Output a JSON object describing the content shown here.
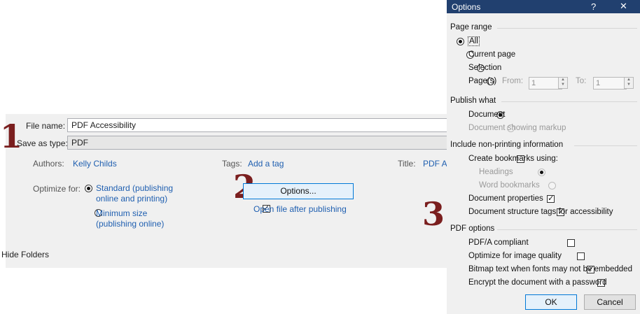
{
  "save_dialog": {
    "file_name_label": "File name:",
    "file_name_value": "PDF Accessibility",
    "save_as_type_label": "Save as type:",
    "save_as_type_value": "PDF",
    "authors_label": "Authors:",
    "authors_value": "Kelly Childs",
    "tags_label": "Tags:",
    "tags_value": "Add a tag",
    "title_label": "Title:",
    "title_value": "PDF Ac",
    "optimize_label": "Optimize for:",
    "optimize_standard_line1": "Standard (publishing",
    "optimize_standard_line2": "online and printing)",
    "optimize_minimum_line1": "Minimum size",
    "optimize_minimum_line2": "(publishing online)",
    "options_button": "Options...",
    "open_after_label": "Open file after publishing",
    "hide_folders": "Hide Folders"
  },
  "step_numbers": {
    "one": "1",
    "two": "2",
    "three": "3"
  },
  "options_dialog": {
    "title": "Options",
    "help_glyph": "?",
    "close_glyph": "✕",
    "page_range": {
      "heading": "Page range",
      "all": "All",
      "current_page": "Current page",
      "selection": "Selection",
      "pages": "Page(s)",
      "from_label": "From:",
      "from_value": "1",
      "to_label": "To:",
      "to_value": "1"
    },
    "publish_what": {
      "heading": "Publish what",
      "document": "Document",
      "document_markup": "Document showing markup"
    },
    "non_printing": {
      "heading": "Include non-printing information",
      "create_bookmarks": "Create bookmarks using:",
      "headings": "Headings",
      "word_bookmarks": "Word bookmarks",
      "doc_properties": "Document properties",
      "structure_tags": "Document structure tags for accessibility"
    },
    "pdf_options": {
      "heading": "PDF options",
      "pdfa": "PDF/A compliant",
      "optimize_image": "Optimize for image quality",
      "bitmap_text": "Bitmap text when fonts may not be embedded",
      "encrypt": "Encrypt the document with a password"
    },
    "ok_button": "OK",
    "cancel_button": "Cancel"
  },
  "colors": {
    "titlebar": "#21406f",
    "link": "#1f5fb0",
    "step_number": "#7a1e1e"
  }
}
